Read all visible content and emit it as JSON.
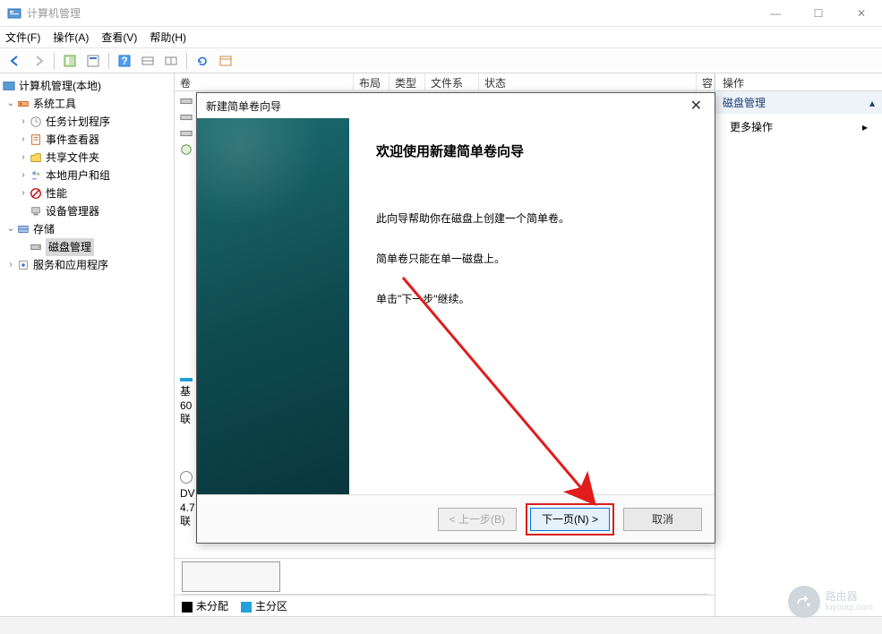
{
  "window": {
    "title": "计算机管理",
    "min": "—",
    "max": "☐",
    "close": "✕"
  },
  "menu": {
    "file": "文件(F)",
    "action": "操作(A)",
    "view": "查看(V)",
    "help": "帮助(H)"
  },
  "tree": {
    "root": "计算机管理(本地)",
    "system_tools": "系统工具",
    "task_scheduler": "任务计划程序",
    "event_viewer": "事件查看器",
    "shared_folders": "共享文件夹",
    "local_users": "本地用户和组",
    "performance": "性能",
    "device_manager": "设备管理器",
    "storage": "存储",
    "disk_management": "磁盘管理",
    "services": "服务和应用程序"
  },
  "columns": {
    "volume": "卷",
    "layout": "布局",
    "type": "类型",
    "fs": "文件系统",
    "status": "状态",
    "cap": "容"
  },
  "actions": {
    "header": "操作",
    "section": "磁盘管理",
    "more": "更多操作"
  },
  "diskmap": {
    "peek1_line1": "基",
    "peek1_line2": "60",
    "peek1_line3": "联",
    "peek2_line1": "DV",
    "peek2_line2": "4.7",
    "peek2_line3": "联",
    "legend_unalloc": "未分配",
    "legend_primary": "主分区"
  },
  "wizard": {
    "title": "新建简单卷向导",
    "heading": "欢迎使用新建简单卷向导",
    "p1": "此向导帮助你在磁盘上创建一个简单卷。",
    "p2": "简单卷只能在单一磁盘上。",
    "p3": "单击\"下一步\"继续。",
    "back": "< 上一步(B)",
    "next": "下一页(N) >",
    "cancel": "取消"
  },
  "watermark": {
    "main": "路由器",
    "sub": "luyouqi.com"
  }
}
